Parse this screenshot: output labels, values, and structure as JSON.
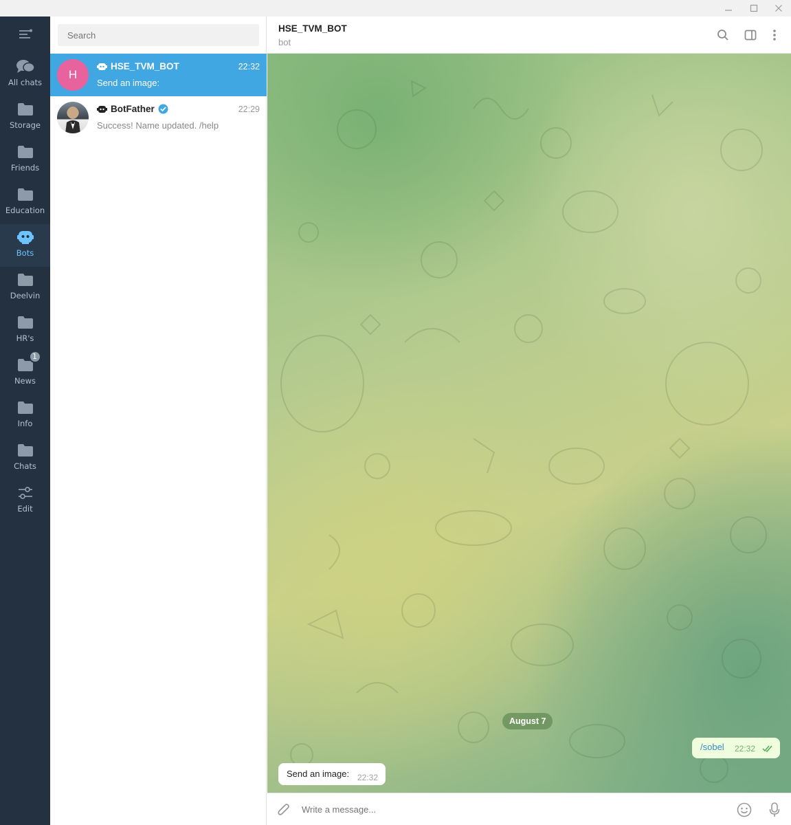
{
  "window": {
    "minimize_icon": "minimize-icon",
    "maximize_icon": "maximize-icon",
    "close_icon": "close-icon"
  },
  "folders": {
    "menu_icon": "hamburger-icon",
    "items": [
      {
        "label": "All chats",
        "icon": "chats-icon"
      },
      {
        "label": "Storage",
        "icon": "folder-icon"
      },
      {
        "label": "Friends",
        "icon": "folder-icon"
      },
      {
        "label": "Education",
        "icon": "folder-icon"
      },
      {
        "label": "Bots",
        "icon": "bot-icon",
        "active": true
      },
      {
        "label": "Deelvin",
        "icon": "folder-icon"
      },
      {
        "label": "HR's",
        "icon": "folder-icon"
      },
      {
        "label": "News",
        "icon": "folder-icon",
        "badge": "1"
      },
      {
        "label": "Info",
        "icon": "folder-icon"
      },
      {
        "label": "Chats",
        "icon": "folder-icon"
      },
      {
        "label": "Edit",
        "icon": "sliders-icon"
      }
    ]
  },
  "search": {
    "placeholder": "Search"
  },
  "chats": [
    {
      "name": "HSE_TVM_BOT",
      "avatar_letter": "H",
      "avatar_color": "#e8639d",
      "time": "22:32",
      "preview": "Send an image:",
      "active": true
    },
    {
      "name": "BotFather",
      "verified": true,
      "time": "22:29",
      "preview": "Success! Name updated. /help"
    }
  ],
  "conversation": {
    "title": "HSE_TVM_BOT",
    "subtitle": "bot",
    "date_separator": "August 7",
    "messages": [
      {
        "direction": "out",
        "text": "/sobel",
        "time": "22:32",
        "status": "read"
      },
      {
        "direction": "in",
        "text": "Send an image:",
        "time": "22:32"
      }
    ]
  },
  "composer": {
    "placeholder": "Write a message..."
  },
  "colors": {
    "sidebar_bg": "#243140",
    "accent": "#40a7e3",
    "active_folder_text": "#6cc3ff",
    "outgoing_bubble": "#effdde",
    "read_check": "#4fae4e"
  }
}
